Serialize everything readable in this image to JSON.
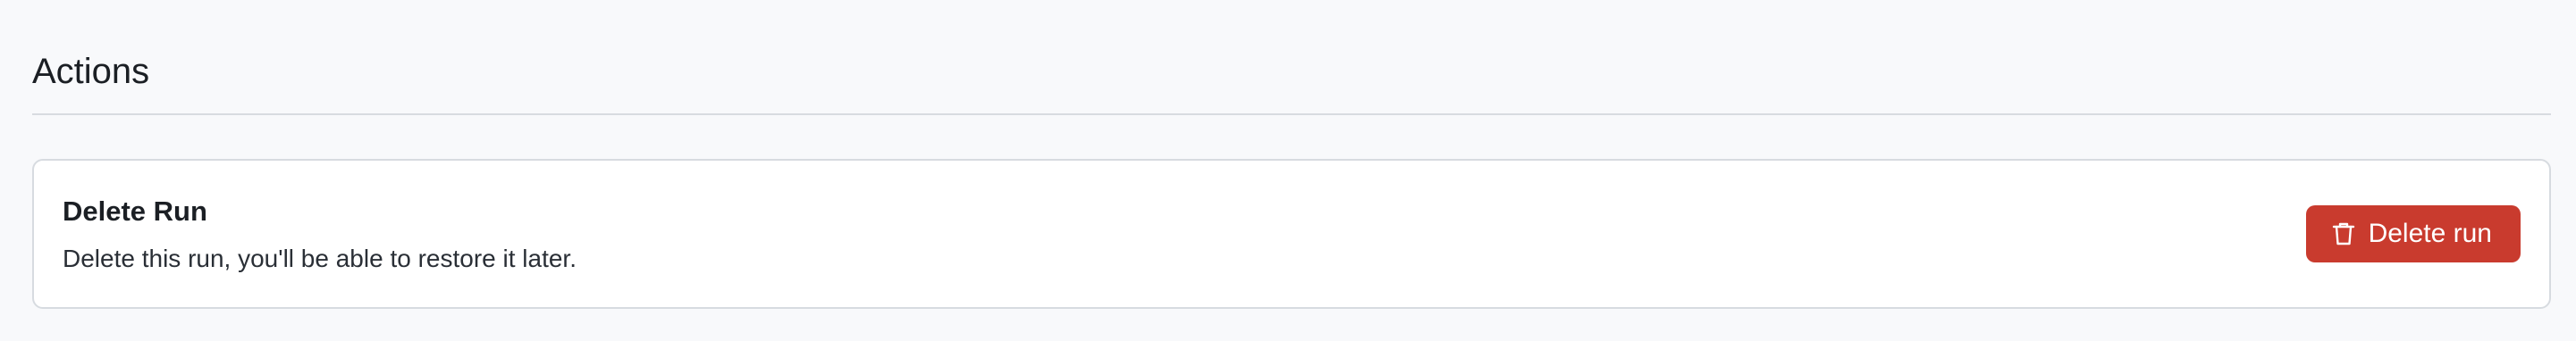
{
  "actions": {
    "title": "Actions",
    "delete_card": {
      "title": "Delete Run",
      "description": "Delete this run, you'll be able to restore it later.",
      "button_label": "Delete run",
      "button_icon": "trash-icon"
    }
  },
  "colors": {
    "background": "#f8f9fb",
    "card_background": "#ffffff",
    "border": "#d7dbe0",
    "danger": "#c93b2e",
    "text": "#1b1f24"
  }
}
